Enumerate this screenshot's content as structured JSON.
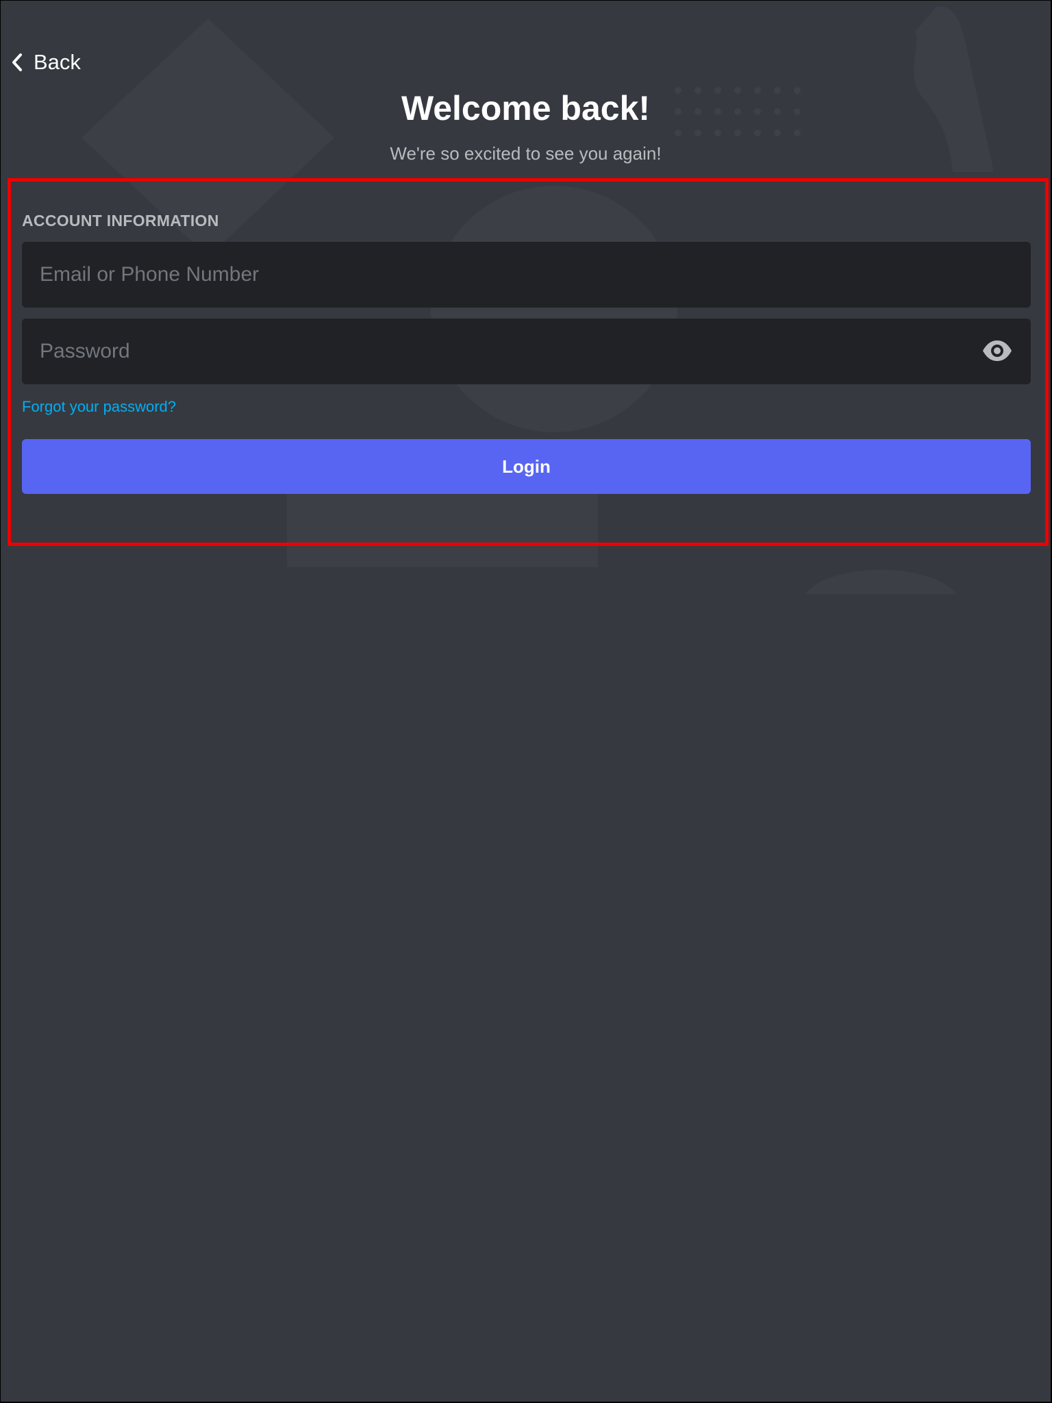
{
  "header": {
    "back_label": "Back",
    "title": "Welcome back!",
    "subtitle": "We're so excited to see you again!"
  },
  "form": {
    "section_label": "ACCOUNT INFORMATION",
    "email": {
      "placeholder": "Email or Phone Number",
      "value": ""
    },
    "password": {
      "placeholder": "Password",
      "value": "",
      "toggle_icon": "eye-icon"
    },
    "forgot_label": "Forgot your password?",
    "login_label": "Login"
  },
  "colors": {
    "background": "#363940",
    "input_background": "#202225",
    "accent": "#5865f2",
    "link": "#00aff4",
    "highlight_border": "#ee0000"
  }
}
